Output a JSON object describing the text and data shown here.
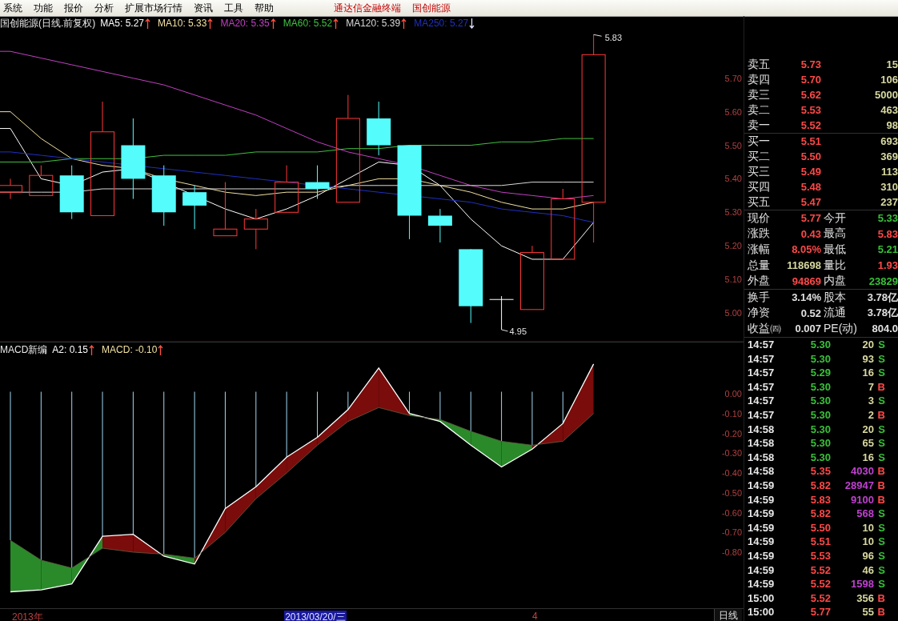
{
  "menu": {
    "items": [
      "系统",
      "功能",
      "报价",
      "分析",
      "扩展市场行情",
      "资讯",
      "工具",
      "帮助"
    ],
    "titles": [
      "通达信金融终端",
      "国创能源"
    ]
  },
  "chart_header": {
    "title": "国创能源(日线.前复权)",
    "legend": [
      {
        "text": "MA5: 5.27",
        "color": "#ffffff",
        "rising": true
      },
      {
        "text": "MA10: 5.33",
        "color": "#f0e0a0",
        "rising": true
      },
      {
        "text": "MA20: 5.35",
        "color": "#c040c0",
        "rising": true
      },
      {
        "text": "MA60: 5.52",
        "color": "#40c040",
        "rising": true
      },
      {
        "text": "MA120: 5.39",
        "color": "#d8d8d8",
        "rising": true
      },
      {
        "text": "MA250: 5.27",
        "color": "#2030c0",
        "rising": false
      }
    ]
  },
  "price_chart": {
    "axis_labels": [
      "5.70",
      "5.60",
      "5.50",
      "5.40",
      "5.30",
      "5.20",
      "5.10",
      "5.00"
    ],
    "high_label": "5.83",
    "low_label": "4.95"
  },
  "macd_header": {
    "title": "MACD新编",
    "legend": [
      {
        "text": "A2: 0.15",
        "color": "#ffffff",
        "rising": true
      },
      {
        "text": "MACD: -0.10",
        "color": "#f0e0a0",
        "rising": true
      }
    ]
  },
  "macd_chart": {
    "axis_labels": [
      "0.00",
      "-0.10",
      "-0.20",
      "-0.30",
      "-0.40",
      "-0.50",
      "-0.60",
      "-0.70",
      "-0.80"
    ]
  },
  "time_axis": {
    "labels": [
      {
        "text": "2013年",
        "kind": "year"
      },
      {
        "text": "2013/03/20/三",
        "kind": "cursor"
      },
      {
        "text": "4",
        "kind": "month"
      }
    ],
    "period_tab": "日线"
  },
  "order_book": [
    {
      "label": "卖五",
      "price": "5.73",
      "volume": "15"
    },
    {
      "label": "卖四",
      "price": "5.70",
      "volume": "106"
    },
    {
      "label": "卖三",
      "price": "5.62",
      "volume": "5000"
    },
    {
      "label": "卖二",
      "price": "5.53",
      "volume": "463"
    },
    {
      "label": "卖一",
      "price": "5.52",
      "volume": "98"
    },
    {
      "label": "买一",
      "price": "5.51",
      "volume": "693"
    },
    {
      "label": "买二",
      "price": "5.50",
      "volume": "369"
    },
    {
      "label": "买三",
      "price": "5.49",
      "volume": "113"
    },
    {
      "label": "买四",
      "price": "5.48",
      "volume": "310"
    },
    {
      "label": "买五",
      "price": "5.47",
      "volume": "237"
    }
  ],
  "stats": [
    [
      {
        "label": "现价",
        "value": "5.77",
        "color": "#ff4848"
      },
      {
        "label": "今开",
        "value": "5.33",
        "color": "#38c038"
      }
    ],
    [
      {
        "label": "涨跌",
        "value": "0.43",
        "color": "#ff4848"
      },
      {
        "label": "最高",
        "value": "5.83",
        "color": "#ff4848"
      }
    ],
    [
      {
        "label": "涨幅",
        "value": "8.05%",
        "color": "#ff4848"
      },
      {
        "label": "最低",
        "value": "5.21",
        "color": "#38c038"
      }
    ],
    [
      {
        "label": "总量",
        "value": "118698",
        "color": "#d8d8a0"
      },
      {
        "label": "量比",
        "value": "1.93",
        "color": "#ff4848"
      }
    ],
    [
      {
        "label": "外盘",
        "value": "94869",
        "color": "#ff4848"
      },
      {
        "label": "内盘",
        "value": "23829",
        "color": "#38c038"
      }
    ],
    [
      {
        "label": "换手",
        "value": "3.14%",
        "color": "#e0e0e0"
      },
      {
        "label": "股本",
        "value": "3.78亿",
        "color": "#e0e0e0"
      }
    ],
    [
      {
        "label": "净资",
        "value": "0.52",
        "color": "#e0e0e0"
      },
      {
        "label": "流通",
        "value": "3.78亿",
        "color": "#e0e0e0"
      }
    ],
    [
      {
        "label": "收益㈣",
        "value": "0.007",
        "color": "#e0e0e0"
      },
      {
        "label": "PE(动)",
        "value": "804.0",
        "color": "#e0e0e0"
      }
    ]
  ],
  "trades": [
    {
      "time": "14:57",
      "price": "5.30",
      "rising": false,
      "volume": "20",
      "large": false,
      "side": "S",
      "kind": "sell"
    },
    {
      "time": "14:57",
      "price": "5.30",
      "rising": false,
      "volume": "93",
      "large": false,
      "side": "S",
      "kind": "sell"
    },
    {
      "time": "14:57",
      "price": "5.29",
      "rising": false,
      "volume": "16",
      "large": false,
      "side": "S",
      "kind": "sell"
    },
    {
      "time": "14:57",
      "price": "5.30",
      "rising": false,
      "volume": "7",
      "large": false,
      "side": "B",
      "kind": "buy"
    },
    {
      "time": "14:57",
      "price": "5.30",
      "rising": false,
      "volume": "3",
      "large": false,
      "side": "S",
      "kind": "sell"
    },
    {
      "time": "14:57",
      "price": "5.30",
      "rising": false,
      "volume": "2",
      "large": false,
      "side": "B",
      "kind": "buy"
    },
    {
      "time": "14:58",
      "price": "5.30",
      "rising": false,
      "volume": "20",
      "large": false,
      "side": "S",
      "kind": "sell"
    },
    {
      "time": "14:58",
      "price": "5.30",
      "rising": false,
      "volume": "65",
      "large": false,
      "side": "S",
      "kind": "sell"
    },
    {
      "time": "14:58",
      "price": "5.30",
      "rising": false,
      "volume": "16",
      "large": false,
      "side": "S",
      "kind": "sell"
    },
    {
      "time": "14:58",
      "price": "5.35",
      "rising": true,
      "volume": "4030",
      "large": true,
      "side": "B",
      "kind": "buy"
    },
    {
      "time": "14:59",
      "price": "5.82",
      "rising": true,
      "volume": "28947",
      "large": true,
      "side": "B",
      "kind": "buy"
    },
    {
      "time": "14:59",
      "price": "5.83",
      "rising": true,
      "volume": "9100",
      "large": true,
      "side": "B",
      "kind": "buy"
    },
    {
      "time": "14:59",
      "price": "5.82",
      "rising": true,
      "volume": "568",
      "large": true,
      "side": "S",
      "kind": "sell"
    },
    {
      "time": "14:59",
      "price": "5.50",
      "rising": true,
      "volume": "10",
      "large": false,
      "side": "S",
      "kind": "sell"
    },
    {
      "time": "14:59",
      "price": "5.51",
      "rising": true,
      "volume": "10",
      "large": false,
      "side": "S",
      "kind": "sell"
    },
    {
      "time": "14:59",
      "price": "5.53",
      "rising": true,
      "volume": "96",
      "large": false,
      "side": "S",
      "kind": "sell"
    },
    {
      "time": "14:59",
      "price": "5.52",
      "rising": true,
      "volume": "46",
      "large": false,
      "side": "S",
      "kind": "sell"
    },
    {
      "time": "14:59",
      "price": "5.52",
      "rising": true,
      "volume": "1598",
      "large": true,
      "side": "S",
      "kind": "sell"
    },
    {
      "time": "15:00",
      "price": "5.52",
      "rising": true,
      "volume": "356",
      "large": false,
      "side": "B",
      "kind": "buy"
    },
    {
      "time": "15:00",
      "price": "5.77",
      "rising": true,
      "volume": "55",
      "large": false,
      "side": "B",
      "kind": "buy"
    }
  ]
}
